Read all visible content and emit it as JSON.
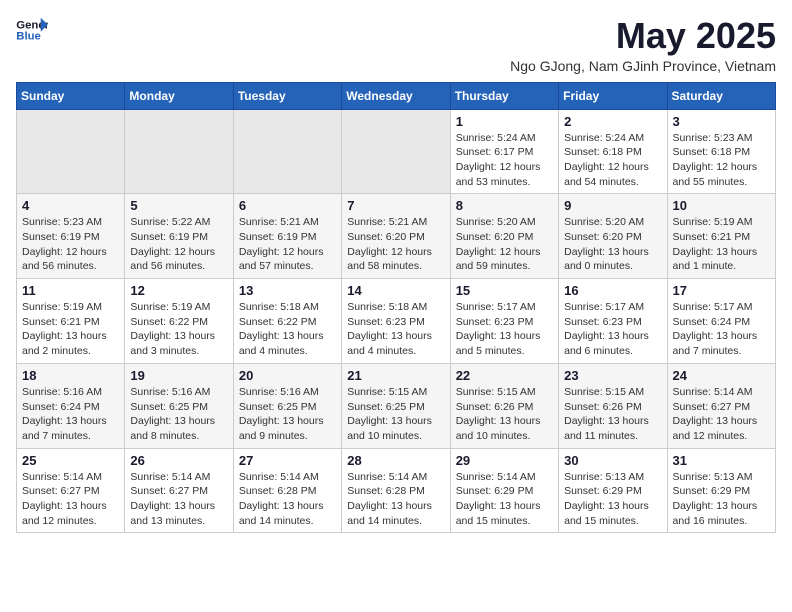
{
  "header": {
    "logo_line1": "General",
    "logo_line2": "Blue",
    "title": "May 2025",
    "subtitle": "Ngo GJong, Nam GJinh Province, Vietnam"
  },
  "days_of_week": [
    "Sunday",
    "Monday",
    "Tuesday",
    "Wednesday",
    "Thursday",
    "Friday",
    "Saturday"
  ],
  "weeks": [
    [
      {
        "day": "",
        "info": ""
      },
      {
        "day": "",
        "info": ""
      },
      {
        "day": "",
        "info": ""
      },
      {
        "day": "",
        "info": ""
      },
      {
        "day": "1",
        "info": "Sunrise: 5:24 AM\nSunset: 6:17 PM\nDaylight: 12 hours\nand 53 minutes."
      },
      {
        "day": "2",
        "info": "Sunrise: 5:24 AM\nSunset: 6:18 PM\nDaylight: 12 hours\nand 54 minutes."
      },
      {
        "day": "3",
        "info": "Sunrise: 5:23 AM\nSunset: 6:18 PM\nDaylight: 12 hours\nand 55 minutes."
      }
    ],
    [
      {
        "day": "4",
        "info": "Sunrise: 5:23 AM\nSunset: 6:19 PM\nDaylight: 12 hours\nand 56 minutes."
      },
      {
        "day": "5",
        "info": "Sunrise: 5:22 AM\nSunset: 6:19 PM\nDaylight: 12 hours\nand 56 minutes."
      },
      {
        "day": "6",
        "info": "Sunrise: 5:21 AM\nSunset: 6:19 PM\nDaylight: 12 hours\nand 57 minutes."
      },
      {
        "day": "7",
        "info": "Sunrise: 5:21 AM\nSunset: 6:20 PM\nDaylight: 12 hours\nand 58 minutes."
      },
      {
        "day": "8",
        "info": "Sunrise: 5:20 AM\nSunset: 6:20 PM\nDaylight: 12 hours\nand 59 minutes."
      },
      {
        "day": "9",
        "info": "Sunrise: 5:20 AM\nSunset: 6:20 PM\nDaylight: 13 hours\nand 0 minutes."
      },
      {
        "day": "10",
        "info": "Sunrise: 5:19 AM\nSunset: 6:21 PM\nDaylight: 13 hours\nand 1 minute."
      }
    ],
    [
      {
        "day": "11",
        "info": "Sunrise: 5:19 AM\nSunset: 6:21 PM\nDaylight: 13 hours\nand 2 minutes."
      },
      {
        "day": "12",
        "info": "Sunrise: 5:19 AM\nSunset: 6:22 PM\nDaylight: 13 hours\nand 3 minutes."
      },
      {
        "day": "13",
        "info": "Sunrise: 5:18 AM\nSunset: 6:22 PM\nDaylight: 13 hours\nand 4 minutes."
      },
      {
        "day": "14",
        "info": "Sunrise: 5:18 AM\nSunset: 6:23 PM\nDaylight: 13 hours\nand 4 minutes."
      },
      {
        "day": "15",
        "info": "Sunrise: 5:17 AM\nSunset: 6:23 PM\nDaylight: 13 hours\nand 5 minutes."
      },
      {
        "day": "16",
        "info": "Sunrise: 5:17 AM\nSunset: 6:23 PM\nDaylight: 13 hours\nand 6 minutes."
      },
      {
        "day": "17",
        "info": "Sunrise: 5:17 AM\nSunset: 6:24 PM\nDaylight: 13 hours\nand 7 minutes."
      }
    ],
    [
      {
        "day": "18",
        "info": "Sunrise: 5:16 AM\nSunset: 6:24 PM\nDaylight: 13 hours\nand 7 minutes."
      },
      {
        "day": "19",
        "info": "Sunrise: 5:16 AM\nSunset: 6:25 PM\nDaylight: 13 hours\nand 8 minutes."
      },
      {
        "day": "20",
        "info": "Sunrise: 5:16 AM\nSunset: 6:25 PM\nDaylight: 13 hours\nand 9 minutes."
      },
      {
        "day": "21",
        "info": "Sunrise: 5:15 AM\nSunset: 6:25 PM\nDaylight: 13 hours\nand 10 minutes."
      },
      {
        "day": "22",
        "info": "Sunrise: 5:15 AM\nSunset: 6:26 PM\nDaylight: 13 hours\nand 10 minutes."
      },
      {
        "day": "23",
        "info": "Sunrise: 5:15 AM\nSunset: 6:26 PM\nDaylight: 13 hours\nand 11 minutes."
      },
      {
        "day": "24",
        "info": "Sunrise: 5:14 AM\nSunset: 6:27 PM\nDaylight: 13 hours\nand 12 minutes."
      }
    ],
    [
      {
        "day": "25",
        "info": "Sunrise: 5:14 AM\nSunset: 6:27 PM\nDaylight: 13 hours\nand 12 minutes."
      },
      {
        "day": "26",
        "info": "Sunrise: 5:14 AM\nSunset: 6:27 PM\nDaylight: 13 hours\nand 13 minutes."
      },
      {
        "day": "27",
        "info": "Sunrise: 5:14 AM\nSunset: 6:28 PM\nDaylight: 13 hours\nand 14 minutes."
      },
      {
        "day": "28",
        "info": "Sunrise: 5:14 AM\nSunset: 6:28 PM\nDaylight: 13 hours\nand 14 minutes."
      },
      {
        "day": "29",
        "info": "Sunrise: 5:14 AM\nSunset: 6:29 PM\nDaylight: 13 hours\nand 15 minutes."
      },
      {
        "day": "30",
        "info": "Sunrise: 5:13 AM\nSunset: 6:29 PM\nDaylight: 13 hours\nand 15 minutes."
      },
      {
        "day": "31",
        "info": "Sunrise: 5:13 AM\nSunset: 6:29 PM\nDaylight: 13 hours\nand 16 minutes."
      }
    ]
  ]
}
